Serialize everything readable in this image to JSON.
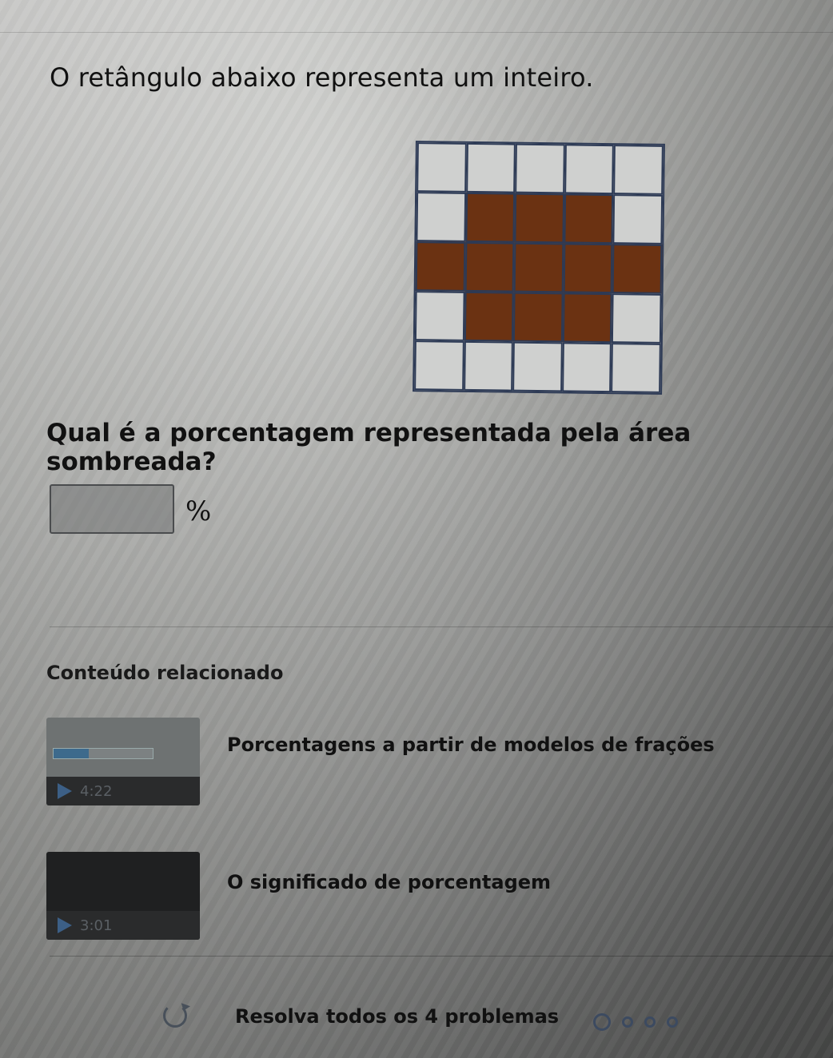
{
  "prompt": "O retângulo abaixo representa um inteiro.",
  "grid": {
    "rows": 5,
    "cols": 5,
    "shaded": [
      [
        0,
        0,
        0,
        0,
        0
      ],
      [
        0,
        1,
        1,
        1,
        0
      ],
      [
        1,
        1,
        1,
        1,
        1
      ],
      [
        0,
        1,
        1,
        1,
        0
      ],
      [
        0,
        0,
        0,
        0,
        0
      ]
    ],
    "colors": {
      "shaded": "#6b3212",
      "empty": "#cfd0cf",
      "border": "#2d3a55"
    }
  },
  "question": "Qual é a porcentagem representada pela área sombreada?",
  "answer": {
    "value": "",
    "unit": "%"
  },
  "related": {
    "heading": "Conteúdo relacionado",
    "videos": [
      {
        "title": "Porcentagens a partir de modelos de frações",
        "duration": "4:22",
        "icon": "play-icon"
      },
      {
        "title": "O significado de porcentagem",
        "duration": "3:01",
        "icon": "play-icon"
      }
    ]
  },
  "footer": {
    "status": "Resolva todos os 4 problemas",
    "icon": "refresh-icon",
    "problem_count": 4
  }
}
